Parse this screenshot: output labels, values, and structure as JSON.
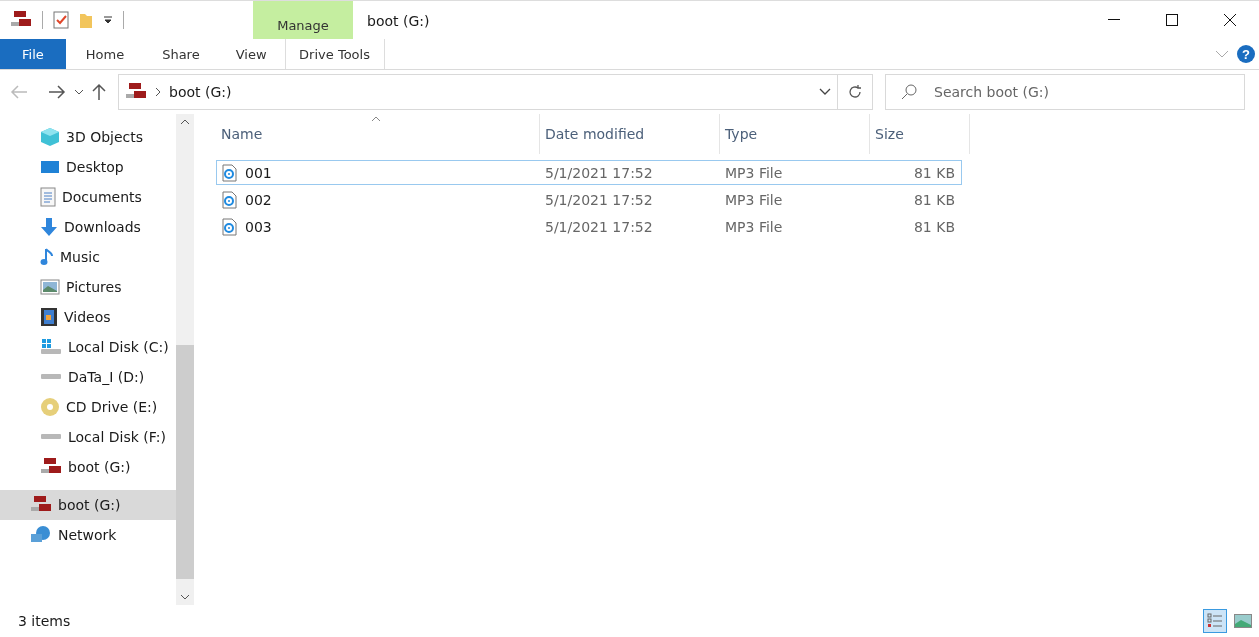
{
  "window": {
    "title": "boot (G:)"
  },
  "ribbon": {
    "context_group": "Manage",
    "tabs": [
      {
        "label": "File",
        "kind": "file"
      },
      {
        "label": "Home",
        "kind": "plain"
      },
      {
        "label": "Share",
        "kind": "plain"
      },
      {
        "label": "View",
        "kind": "plain"
      },
      {
        "label": "Drive Tools",
        "kind": "context"
      }
    ],
    "help": "?"
  },
  "address": {
    "path": "boot (G:)"
  },
  "search": {
    "placeholder": "Search boot (G:)"
  },
  "sidebar": {
    "nested_items": [
      {
        "label": "3D Objects",
        "kind": "cube",
        "selected": false
      },
      {
        "label": "Desktop",
        "kind": "desktop",
        "selected": false
      },
      {
        "label": "Documents",
        "kind": "document",
        "selected": false
      },
      {
        "label": "Downloads",
        "kind": "download",
        "selected": false
      },
      {
        "label": "Music",
        "kind": "music",
        "selected": false
      },
      {
        "label": "Pictures",
        "kind": "picture",
        "selected": false
      },
      {
        "label": "Videos",
        "kind": "video",
        "selected": false
      },
      {
        "label": "Local Disk (C:)",
        "kind": "system-disk",
        "selected": false
      },
      {
        "label": "DaTa_I (D:)",
        "kind": "disk",
        "selected": false
      },
      {
        "label": "CD Drive (E:)",
        "kind": "cd",
        "selected": false
      },
      {
        "label": "Local Disk (F:)",
        "kind": "disk",
        "selected": false
      },
      {
        "label": "boot (G:)",
        "kind": "sd",
        "selected": false
      }
    ],
    "items": [
      {
        "label": "boot (G:)",
        "kind": "sd",
        "selected": true
      },
      {
        "label": "Network",
        "kind": "network",
        "selected": false
      }
    ]
  },
  "table": {
    "columns": [
      {
        "label": "Name",
        "sorted": true
      },
      {
        "label": "Date modified",
        "sorted": false
      },
      {
        "label": "Type",
        "sorted": false
      },
      {
        "label": "Size",
        "sorted": false
      }
    ],
    "rows": [
      {
        "name": "001",
        "date": "5/1/2021 17:52",
        "type": "MP3 File",
        "size": "81 KB",
        "focused": true
      },
      {
        "name": "002",
        "date": "5/1/2021 17:52",
        "type": "MP3 File",
        "size": "81 KB",
        "focused": false
      },
      {
        "name": "003",
        "date": "5/1/2021 17:52",
        "type": "MP3 File",
        "size": "81 KB",
        "focused": false
      }
    ]
  },
  "status_bar": {
    "count": "3 items",
    "views": [
      {
        "kind": "details",
        "selected": true
      },
      {
        "kind": "large-icons",
        "selected": false
      }
    ]
  }
}
